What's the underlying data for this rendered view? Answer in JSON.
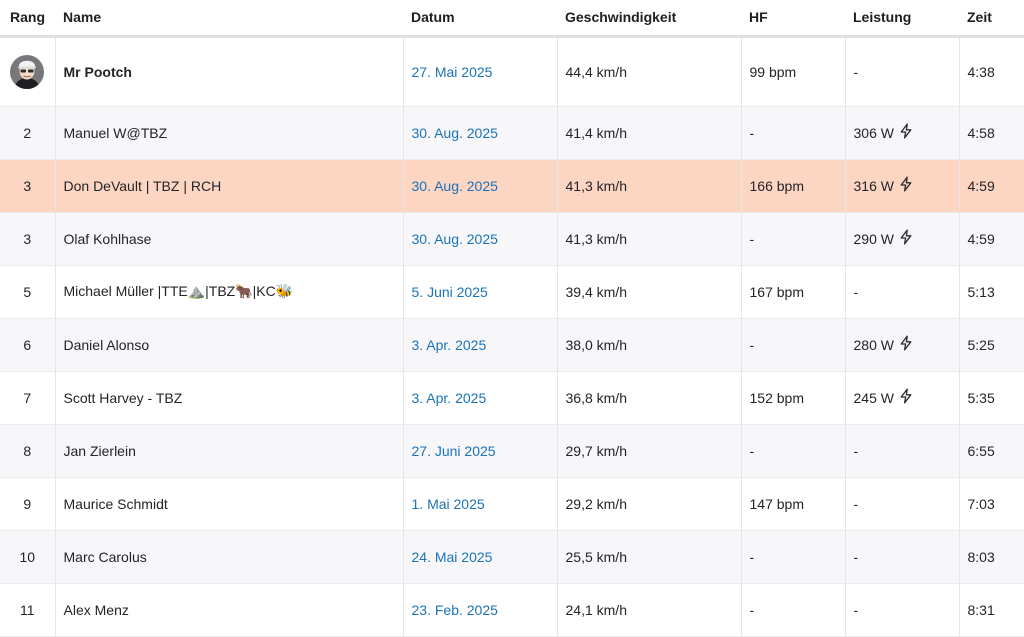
{
  "table": {
    "headers": {
      "rank": "Rang",
      "name": "Name",
      "date": "Datum",
      "speed": "Geschwindigkeit",
      "hr": "HF",
      "power": "Leistung",
      "time": "Zeit"
    },
    "rows": [
      {
        "rank": "",
        "name": "Mr Pootch",
        "date": "27. Mai 2025",
        "speed": "44,4 km/h",
        "hr": "99 bpm",
        "power": "-",
        "time": "4:38",
        "current_user": true
      },
      {
        "rank": "2",
        "name": "Manuel W@TBZ",
        "date": "30. Aug. 2025",
        "speed": "41,4 km/h",
        "hr": "-",
        "power": "306 W",
        "time": "4:58"
      },
      {
        "rank": "3",
        "name": "Don DeVault | TBZ | RCH",
        "date": "30. Aug. 2025",
        "speed": "41,3 km/h",
        "hr": "166 bpm",
        "power": "316 W",
        "time": "4:59",
        "highlighted": true
      },
      {
        "rank": "3",
        "name": "Olaf Kohlhase",
        "date": "30. Aug. 2025",
        "speed": "41,3 km/h",
        "hr": "-",
        "power": "290 W",
        "time": "4:59"
      },
      {
        "rank": "5",
        "name": "Michael Müller |TTE⛰️|TBZ🐂|KC🐝",
        "date": "5. Juni 2025",
        "speed": "39,4 km/h",
        "hr": "167 bpm",
        "power": "-",
        "time": "5:13"
      },
      {
        "rank": "6",
        "name": "Daniel Alonso",
        "date": "3. Apr. 2025",
        "speed": "38,0 km/h",
        "hr": "-",
        "power": "280 W",
        "time": "5:25"
      },
      {
        "rank": "7",
        "name": "Scott Harvey - TBZ",
        "date": "3. Apr. 2025",
        "speed": "36,8 km/h",
        "hr": "152 bpm",
        "power": "245 W",
        "time": "5:35"
      },
      {
        "rank": "8",
        "name": "Jan Zierlein",
        "date": "27. Juni 2025",
        "speed": "29,7 km/h",
        "hr": "-",
        "power": "-",
        "time": "6:55"
      },
      {
        "rank": "9",
        "name": "Maurice Schmidt",
        "date": "1. Mai 2025",
        "speed": "29,2 km/h",
        "hr": "147 bpm",
        "power": "-",
        "time": "7:03"
      },
      {
        "rank": "10",
        "name": "Marc Carolus",
        "date": "24. Mai 2025",
        "speed": "25,5 km/h",
        "hr": "-",
        "power": "-",
        "time": "8:03"
      },
      {
        "rank": "11",
        "name": "Alex Menz",
        "date": "23. Feb. 2025",
        "speed": "24,1 km/h",
        "hr": "-",
        "power": "-",
        "time": "8:31"
      }
    ]
  },
  "icons": {
    "power_measured": "lightning-bolt-icon",
    "avatar": "user-avatar"
  },
  "colors": {
    "link": "#1a73b8",
    "highlight_row": "#fdd5c3",
    "alt_row": "#f7f7fa"
  }
}
